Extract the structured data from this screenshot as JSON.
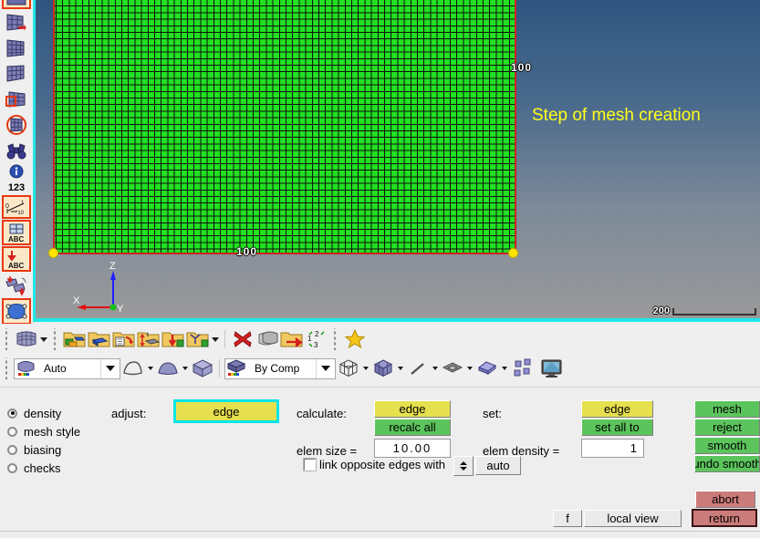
{
  "app": {
    "annotation": "Step of mesh creation"
  },
  "left_toolbar": {
    "items": [
      {
        "name": "mesh-edit-clipped-icon",
        "label": "mesh edit"
      },
      {
        "name": "mesh-arrow-icon",
        "label": "mesh move"
      },
      {
        "name": "mesh-grid-1-icon",
        "label": "mesh grid"
      },
      {
        "name": "mesh-grid-2-icon",
        "label": "mesh surface"
      },
      {
        "name": "mesh-zoom-box-icon",
        "label": "mesh zoom"
      },
      {
        "name": "mesh-circle-icon",
        "label": "mesh circle"
      },
      {
        "name": "binoculars-icon",
        "label": "find"
      },
      {
        "name": "info-circle-icon",
        "label": "info"
      },
      {
        "name": "number-123-icon",
        "label": "123"
      },
      {
        "name": "dimension-angle-icon",
        "label": "dimension"
      },
      {
        "name": "abc-window-icon",
        "label": "ABC"
      },
      {
        "name": "abc-arrow-icon",
        "label": "ABC arrow"
      },
      {
        "name": "swap-elements-icon",
        "label": "swap"
      },
      {
        "name": "surface-patch-icon",
        "label": "surface"
      }
    ],
    "number_label": "123",
    "abc_label_1": "ABC",
    "abc_label_2": "ABC"
  },
  "viewport": {
    "dim_top_right": "100",
    "dim_bottom": "100",
    "scale_value": "200",
    "axes": {
      "x": "X",
      "y": "Y",
      "z": "Z"
    },
    "colors": {
      "mesh_fill": "#22e022",
      "mesh_border": "#cc2222",
      "node": "#ffe400",
      "annotation": "#ffff1a",
      "bg_top": "#2e5580",
      "bg_bottom": "#9a9a9a",
      "frame": "#1fe8e8"
    }
  },
  "toolbar_row1": {
    "items": [
      {
        "name": "mesh-3d-icon",
        "label": "2D mesh"
      },
      {
        "name": "folder-components-icon",
        "label": "components"
      },
      {
        "name": "folder-properties-icon",
        "label": "properties"
      },
      {
        "name": "folder-materials-icon",
        "label": "materials"
      },
      {
        "name": "folder-thickness-icon",
        "label": "thickness"
      },
      {
        "name": "folder-import-icon",
        "label": "import"
      },
      {
        "name": "folder-assembly-icon",
        "label": "assembly"
      },
      {
        "name": "delete-x-icon",
        "label": "delete"
      },
      {
        "name": "layers-icon",
        "label": "layers"
      },
      {
        "name": "folder-open-red-icon",
        "label": "organize"
      },
      {
        "name": "renumber-123-icon",
        "label": "renumber"
      },
      {
        "name": "star-favorite-icon",
        "label": "favorites"
      }
    ]
  },
  "toolbar_row2": {
    "auto_combo": {
      "name": "shading-mode-combo",
      "value": "Auto"
    },
    "by_comp_combo": {
      "name": "color-by-combo",
      "value": "By Comp"
    },
    "items": [
      {
        "name": "surface-wire-icon",
        "label": "wireframe surface"
      },
      {
        "name": "surface-shaded-icon",
        "label": "shaded surface"
      },
      {
        "name": "solid-cube-icon",
        "label": "solid"
      },
      {
        "name": "cube-wire-icon",
        "label": "wireframe elements"
      },
      {
        "name": "cube-shaded-icon",
        "label": "shaded elements"
      },
      {
        "name": "line-element-icon",
        "label": "1d elements"
      },
      {
        "name": "shell-element-icon",
        "label": "2d elements"
      },
      {
        "name": "solid-element-icon",
        "label": "3d elements"
      },
      {
        "name": "mask-icon",
        "label": "mask"
      },
      {
        "name": "monitor-icon",
        "label": "display"
      }
    ]
  },
  "panel": {
    "modes": [
      {
        "label": "density",
        "selected": true
      },
      {
        "label": "mesh style",
        "selected": false
      },
      {
        "label": "biasing",
        "selected": false
      },
      {
        "label": "checks",
        "selected": false
      }
    ],
    "adjust_label": "adjust:",
    "adjust_button": "edge",
    "calculate_label": "calculate:",
    "calculate_edge_button": "edge",
    "recalc_all_button": "recalc all",
    "elem_size_label": "elem size =",
    "elem_size_value": "10.00",
    "link_checkbox_label": "link opposite edges with",
    "auto_button": "auto",
    "set_label": "set:",
    "set_edge_button": "edge",
    "set_all_to_button": "set all to",
    "elem_density_label": "elem density =",
    "elem_density_value": "1",
    "right_buttons": [
      {
        "label": "mesh",
        "style": "green"
      },
      {
        "label": "reject",
        "style": "green"
      },
      {
        "label": "smooth",
        "style": "green"
      },
      {
        "label": "undo smooth",
        "style": "green"
      }
    ],
    "abort_button": "abort",
    "return_button": "return",
    "f_button": "f",
    "local_view_button": "local view"
  }
}
